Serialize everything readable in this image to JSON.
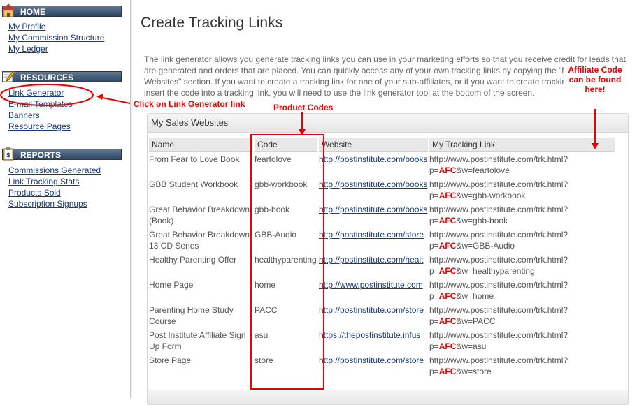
{
  "sidebar": {
    "home": {
      "title": "HOME",
      "links": [
        "My Profile",
        "My Commission Structure",
        "My Ledger"
      ]
    },
    "resources": {
      "title": "RESOURCES",
      "links": [
        "Link Generator",
        "E-mail Templates",
        "Banners",
        "Resource Pages"
      ]
    },
    "reports": {
      "title": "REPORTS",
      "links": [
        "Commissions Generated",
        "Link Tracking Stats",
        "Products Sold",
        "Subscription Signups"
      ]
    }
  },
  "main": {
    "title": "Create Tracking Links",
    "intro": "The link generator allows you generate tracking links you can use in your marketing efforts so that you receive credit for leads that are generated and orders that are placed. You can quickly access any of your own tracking links by copying the \"My Sales Websites\" section. If you want to create a tracking link for one of your sub-affiliates, or if you want to create tracking purposes and insert the code into a tracking link, you will need to use the link generator tool at the bottom of the screen.",
    "panel_title": "My Sales Websites",
    "columns": [
      "Name",
      "Code",
      "Website",
      "My Tracking Link"
    ],
    "rows": [
      {
        "name": "From Fear to Love Book",
        "code": "feartolove",
        "website": "http://postinstitute.com/books",
        "track_pre": "http://www.postinstitute.com/trk.html?p=",
        "track_post": "&w=feartolove"
      },
      {
        "name": "GBB Student Workbook",
        "code": "gbb-workbook",
        "website": "http://postinstitute.com/books",
        "track_pre": "http://www.postinstitute.com/trk.html?p=",
        "track_post": "&w=gbb-workbook"
      },
      {
        "name": "Great Behavior Breakdown (Book)",
        "code": "gbb-book",
        "website": "http://postinstitute.com/books",
        "track_pre": "http://www.postinstitute.com/trk.html?p=",
        "track_post": "&w=gbb-book"
      },
      {
        "name": "Great Behavior Breakdown 13 CD Series",
        "code": "GBB-Audio",
        "website": "http://postinstitute.com/store",
        "track_pre": "http://www.postinstitute.com/trk.html?p=",
        "track_post": "&w=GBB-Audio"
      },
      {
        "name": "Healthy Parenting Offer",
        "code": "healthyparenting",
        "website": "http://postinstitute.com/healt",
        "track_pre": "http://www.postinstitute.com/trk.html?p=",
        "track_post": "&w=healthyparenting"
      },
      {
        "name": "Home Page",
        "code": "home",
        "website": "http://www.postinstitute.com",
        "track_pre": "http://www.postinstitute.com/trk.html?p=",
        "track_post": "&w=home"
      },
      {
        "name": "Parenting Home Study Course",
        "code": "PACC",
        "website": "http://postinstitute.com/store",
        "track_pre": "http://www.postinstitute.com/trk.html?p=",
        "track_post": "&w=PACC"
      },
      {
        "name": "Post Institute Affiliate Sign Up Form",
        "code": "asu",
        "website": "https://thepostinstitute.infus",
        "track_pre": "http://www.postinstitute.com/trk.html?p=",
        "track_post": "&w=asu"
      },
      {
        "name": "Store Page",
        "code": "store",
        "website": "http://postinstitute.com/store",
        "track_pre": "http://www.postinstitute.com/trk.html?p=",
        "track_post": "&w=store"
      }
    ],
    "affiliate_code": "AFC"
  },
  "annotations": {
    "link_generator": "Click on Link Generator link",
    "product_codes": "Product Codes",
    "affiliate_code": "Affiliate Code can be found here!"
  },
  "colors": {
    "annotation": "#ee0000",
    "header_bar": "#2e4663",
    "link": "#1a3c7a"
  },
  "icons": {
    "home": "house-icon",
    "resources": "pencil-note-icon",
    "reports": "clipboard-icon"
  }
}
